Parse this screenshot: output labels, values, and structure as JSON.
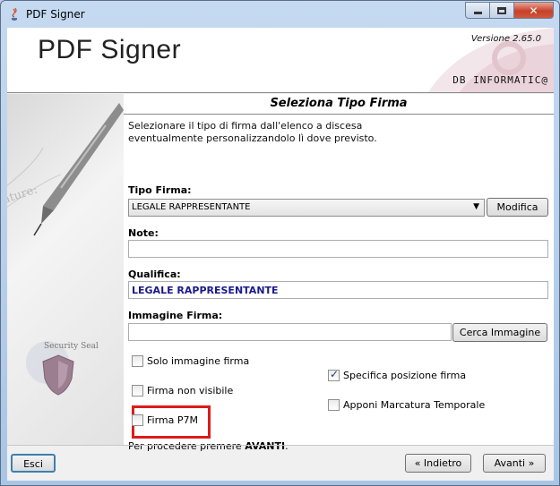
{
  "window": {
    "title": "PDF Signer",
    "app_icon": "java-icon",
    "controls": {
      "minimize": "minimize-icon",
      "maximize": "maximize-icon",
      "close": "close-icon"
    }
  },
  "header": {
    "title": "PDF Signer",
    "version": "Versione  2.65.0",
    "brand": "DB  INFORMATIC@"
  },
  "side_panel": {
    "seal_text": "Security Seal"
  },
  "main": {
    "section_title": "Seleziona Tipo Firma",
    "description_line1": "Selezionare il tipo di firma dall'elenco a discesa",
    "description_line2": "eventualmente personalizzandolo lì dove previsto.",
    "tipo_firma": {
      "label": "Tipo Firma:",
      "selected": "LEGALE RAPPRESENTANTE",
      "modify_button": "Modifica"
    },
    "note": {
      "label": "Note:",
      "value": ""
    },
    "qualifica": {
      "label": "Qualifica:",
      "value": "LEGALE RAPPRESENTANTE"
    },
    "immagine": {
      "label": "Immagine Firma:",
      "value": "",
      "search_button": "Cerca Immagine"
    },
    "options": {
      "solo_immagine": {
        "label": "Solo immagine firma",
        "checked": false
      },
      "specifica_posizione": {
        "label": "Specifica posizione firma",
        "checked": true
      },
      "firma_non_visibile": {
        "label": "Firma non visibile",
        "checked": false
      },
      "apponi_marcatura": {
        "label": "Apponi Marcatura Temporale",
        "checked": false
      },
      "firma_p7m": {
        "label": "Firma P7M",
        "checked": false
      }
    },
    "proceed_prefix": "Per procedere premere ",
    "proceed_bold": "AVANTI",
    "proceed_suffix": "."
  },
  "footer": {
    "exit_button": "Esci",
    "back_button": "« Indietro",
    "next_button": "Avanti »"
  },
  "colors": {
    "highlight": "#e01a1a",
    "qualifica_text": "#1a1a8c",
    "title_close_button": "#c7402a"
  }
}
